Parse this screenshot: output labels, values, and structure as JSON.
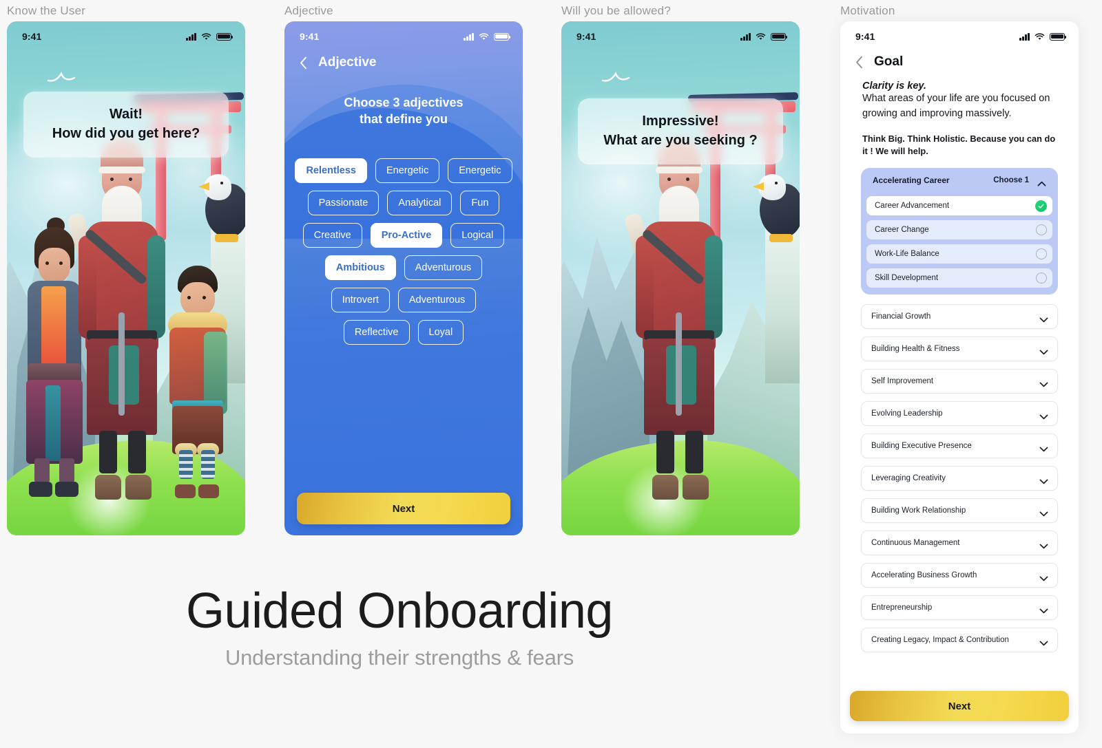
{
  "captions": {
    "panel1": "Know the User",
    "panel2": "Adjective",
    "panel3": "Will you be allowed?",
    "panel4": "Motivation"
  },
  "status_bar": {
    "time": "9:41",
    "icons": [
      "cellular-signal-icon",
      "wifi-icon",
      "battery-icon"
    ]
  },
  "panel1": {
    "bubble_line1": "Wait!",
    "bubble_line2": "How did you get here?"
  },
  "panel2": {
    "nav_title": "Adjective",
    "back_icon": "chevron-left-icon",
    "heading_line1": "Choose 3 adjectives",
    "heading_line2": "that define you",
    "chips": [
      {
        "label": "Relentless",
        "selected": true
      },
      {
        "label": "Energetic",
        "selected": false
      },
      {
        "label": "Energetic",
        "selected": false
      },
      {
        "label": "Passionate",
        "selected": false
      },
      {
        "label": "Analytical",
        "selected": false
      },
      {
        "label": "Fun",
        "selected": false
      },
      {
        "label": "Creative",
        "selected": false
      },
      {
        "label": "Pro-Active",
        "selected": true
      },
      {
        "label": "Logical",
        "selected": false
      },
      {
        "label": "Ambitious",
        "selected": true
      },
      {
        "label": "Adventurous",
        "selected": false
      },
      {
        "label": "Introvert",
        "selected": false
      },
      {
        "label": "Adventurous",
        "selected": false
      },
      {
        "label": "Reflective",
        "selected": false
      },
      {
        "label": "Loyal",
        "selected": false
      }
    ],
    "next_label": "Next"
  },
  "panel3": {
    "bubble_line1": "Impressive!",
    "bubble_line2": "What are you seeking ?"
  },
  "panel4": {
    "nav_title": "Goal",
    "back_icon": "chevron-left-icon",
    "lead": "Clarity is key.",
    "body": "What areas of your life are you focused on growing and improving massively.",
    "body2": "Think Big. Think Holistic. Because you can do it ! We will help.",
    "expanded": {
      "title": "Accelerating Career",
      "hint": "Choose 1",
      "chevron_icon": "chevron-up-icon",
      "options": [
        {
          "label": "Career Advancement",
          "selected": true
        },
        {
          "label": "Career Change",
          "selected": false
        },
        {
          "label": "Work-Life Balance",
          "selected": false
        },
        {
          "label": "Skill Development",
          "selected": false
        }
      ]
    },
    "collapsed": [
      {
        "label": "Financial Growth"
      },
      {
        "label": "Building Health & Fitness"
      },
      {
        "label": "Self Improvement"
      },
      {
        "label": "Evolving Leadership"
      },
      {
        "label": "Building Executive Presence"
      },
      {
        "label": "Leveraging Creativity"
      },
      {
        "label": "Building Work Relationship"
      },
      {
        "label": "Continuous Management"
      },
      {
        "label": "Accelerating Business Growth"
      },
      {
        "label": "Entrepreneurship"
      },
      {
        "label": "Creating Legacy, Impact & Contribution"
      }
    ],
    "chevron_icon": "chevron-down-icon",
    "next_label": "Next"
  },
  "hero": {
    "title": "Guided Onboarding",
    "subtitle": "Understanding their strengths & fears"
  },
  "colors": {
    "accent_gold": "#f3da55",
    "accent_blue": "#3f77dd",
    "accordion_bg": "#bcc9f5",
    "check_green": "#0ec765",
    "page_bg": "#f7f7f7"
  }
}
